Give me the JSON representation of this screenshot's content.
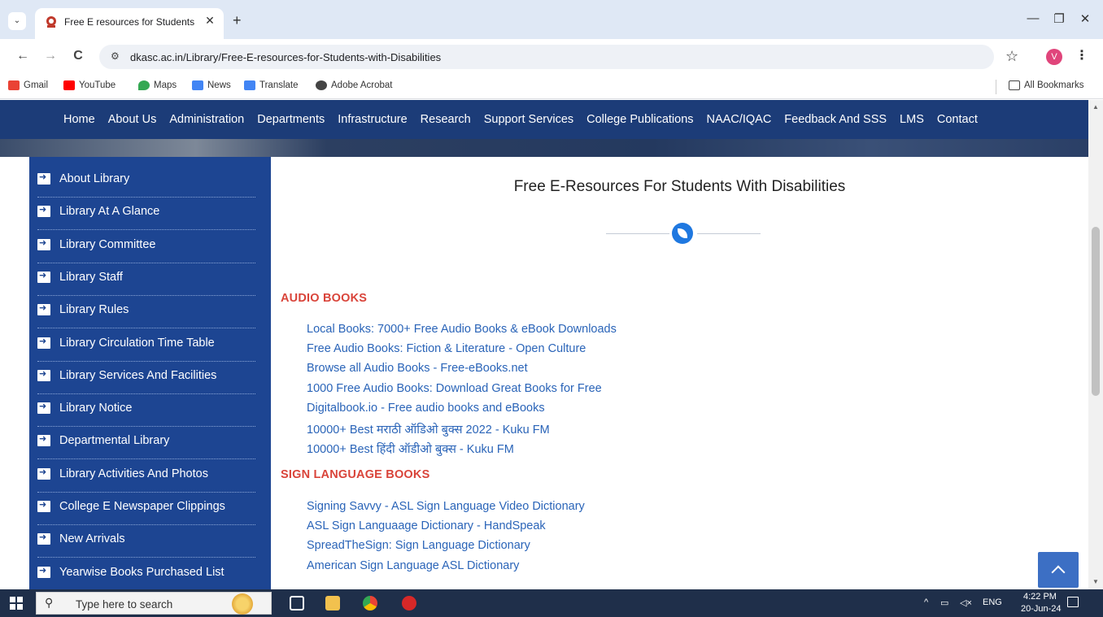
{
  "browser": {
    "tab_title": "Free E resources for Students w",
    "tab_close": "✕",
    "new_tab": "+",
    "url": "dkasc.ac.in/Library/Free-E-resources-for-Students-with-Disabilities",
    "profile_initial": "V",
    "window_controls": {
      "minimize": "—",
      "restore": "❐",
      "close": "✕"
    },
    "nav": {
      "back": "←",
      "forward": "→",
      "reload": "C"
    },
    "bookmarks": [
      {
        "label": "Gmail",
        "icon": "gmail-icon",
        "color": "#ea4335"
      },
      {
        "label": "YouTube",
        "icon": "youtube-icon",
        "color": "#ff0000"
      },
      {
        "label": "Maps",
        "icon": "maps-icon",
        "color": "#34a853"
      },
      {
        "label": "News",
        "icon": "news-icon",
        "color": "#4285f4"
      },
      {
        "label": "Translate",
        "icon": "translate-icon",
        "color": "#4285f4"
      },
      {
        "label": "Adobe Acrobat",
        "icon": "acrobat-icon",
        "color": "#444444"
      }
    ],
    "all_bookmarks": "All Bookmarks"
  },
  "site": {
    "topnav": [
      "Home",
      "About Us",
      "Administration",
      "Departments",
      "Infrastructure",
      "Research",
      "Support Services",
      "College Publications",
      "NAAC/IQAC",
      "Feedback And SSS",
      "LMS",
      "Contact"
    ],
    "sidebar": [
      "About Library",
      "Library At A Glance",
      "Library Committee",
      "Library Staff",
      "Library Rules",
      "Library Circulation Time Table",
      "Library Services And Facilities",
      "Library Notice",
      "Departmental Library",
      "Library Activities And Photos",
      "College E Newspaper Clippings",
      "New Arrivals",
      "Yearwise Books Purchased List"
    ],
    "page_title": "Free E-Resources For Students With Disabilities",
    "sections": [
      {
        "heading": "AUDIO BOOKS",
        "links": [
          "Local Books: 7000+ Free Audio Books & eBook Downloads",
          "Free Audio Books: Fiction & Literature - Open Culture",
          "Browse all Audio Books - Free-eBooks.net",
          "1000 Free Audio Books: Download Great Books for Free",
          "Digitalbook.io - Free audio books and eBooks",
          "10000+ Best मराठी ऑडिओ बुक्स 2022 - Kuku FM",
          "10000+ Best हिंदी ऑडीओ बुक्स - Kuku FM"
        ]
      },
      {
        "heading": "SIGN LANGUAGE BOOKS",
        "links": [
          "Signing Savvy - ASL Sign Language Video Dictionary",
          "ASL Sign Languaage Dictionary - HandSpeak",
          "SpreadTheSign: Sign Language Dictionary",
          "American Sign Language ASL Dictionary"
        ]
      }
    ],
    "colors": {
      "nav_bg": "#1c3c78",
      "sidebar_bg": "#1d4592",
      "heading": "#d9443a",
      "link": "#2a64b8"
    }
  },
  "taskbar": {
    "search_placeholder": "Type here to search",
    "tray_text": "ENG",
    "time": "4:22 PM",
    "date": "20-Jun-24"
  }
}
